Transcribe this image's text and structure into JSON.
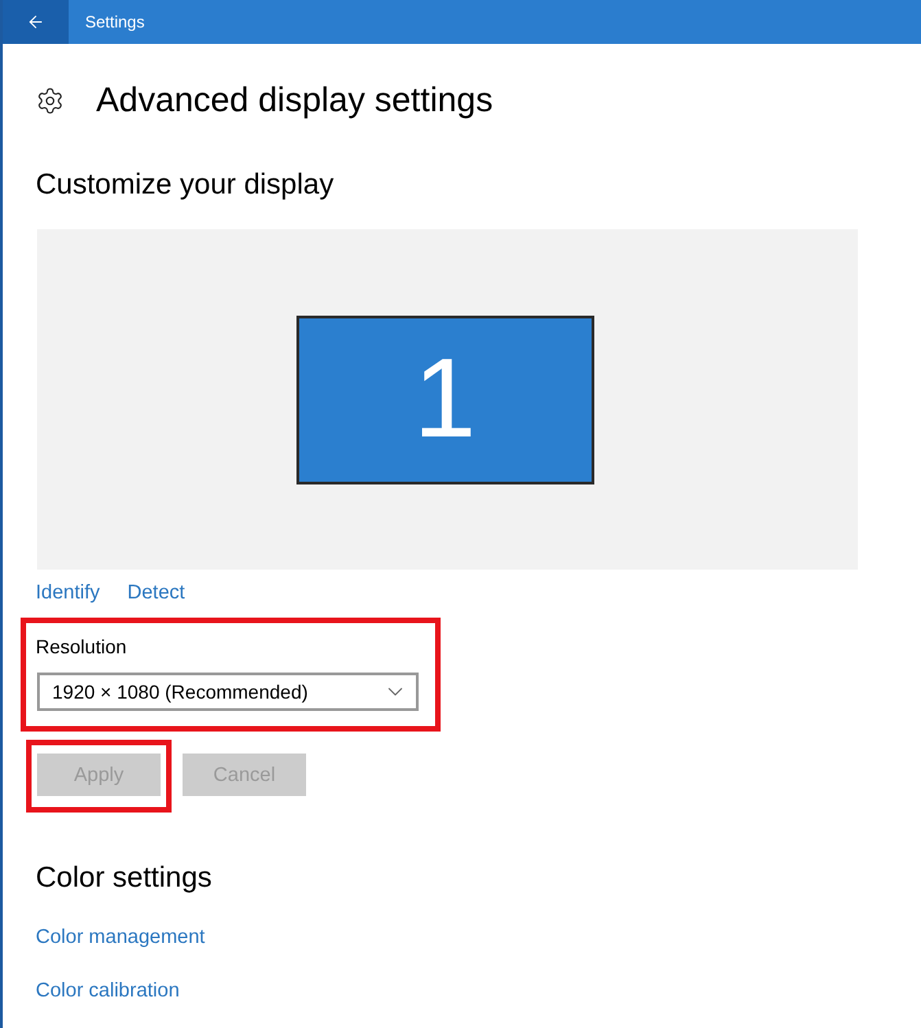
{
  "window": {
    "title": "Settings"
  },
  "page": {
    "title": "Advanced display settings"
  },
  "customize": {
    "heading": "Customize your display",
    "displays": [
      {
        "label": "1",
        "selected": true
      }
    ],
    "links": [
      "Identify",
      "Detect"
    ]
  },
  "resolution": {
    "label": "Resolution",
    "value": "1920 × 1080 (Recommended)",
    "highlighted": true
  },
  "buttons": [
    {
      "label": "Apply",
      "disabled": true,
      "highlighted": true
    },
    {
      "label": "Cancel",
      "disabled": true,
      "highlighted": false
    }
  ],
  "color_settings": {
    "heading": "Color settings",
    "links": [
      "Color management",
      "Color calibration"
    ]
  }
}
